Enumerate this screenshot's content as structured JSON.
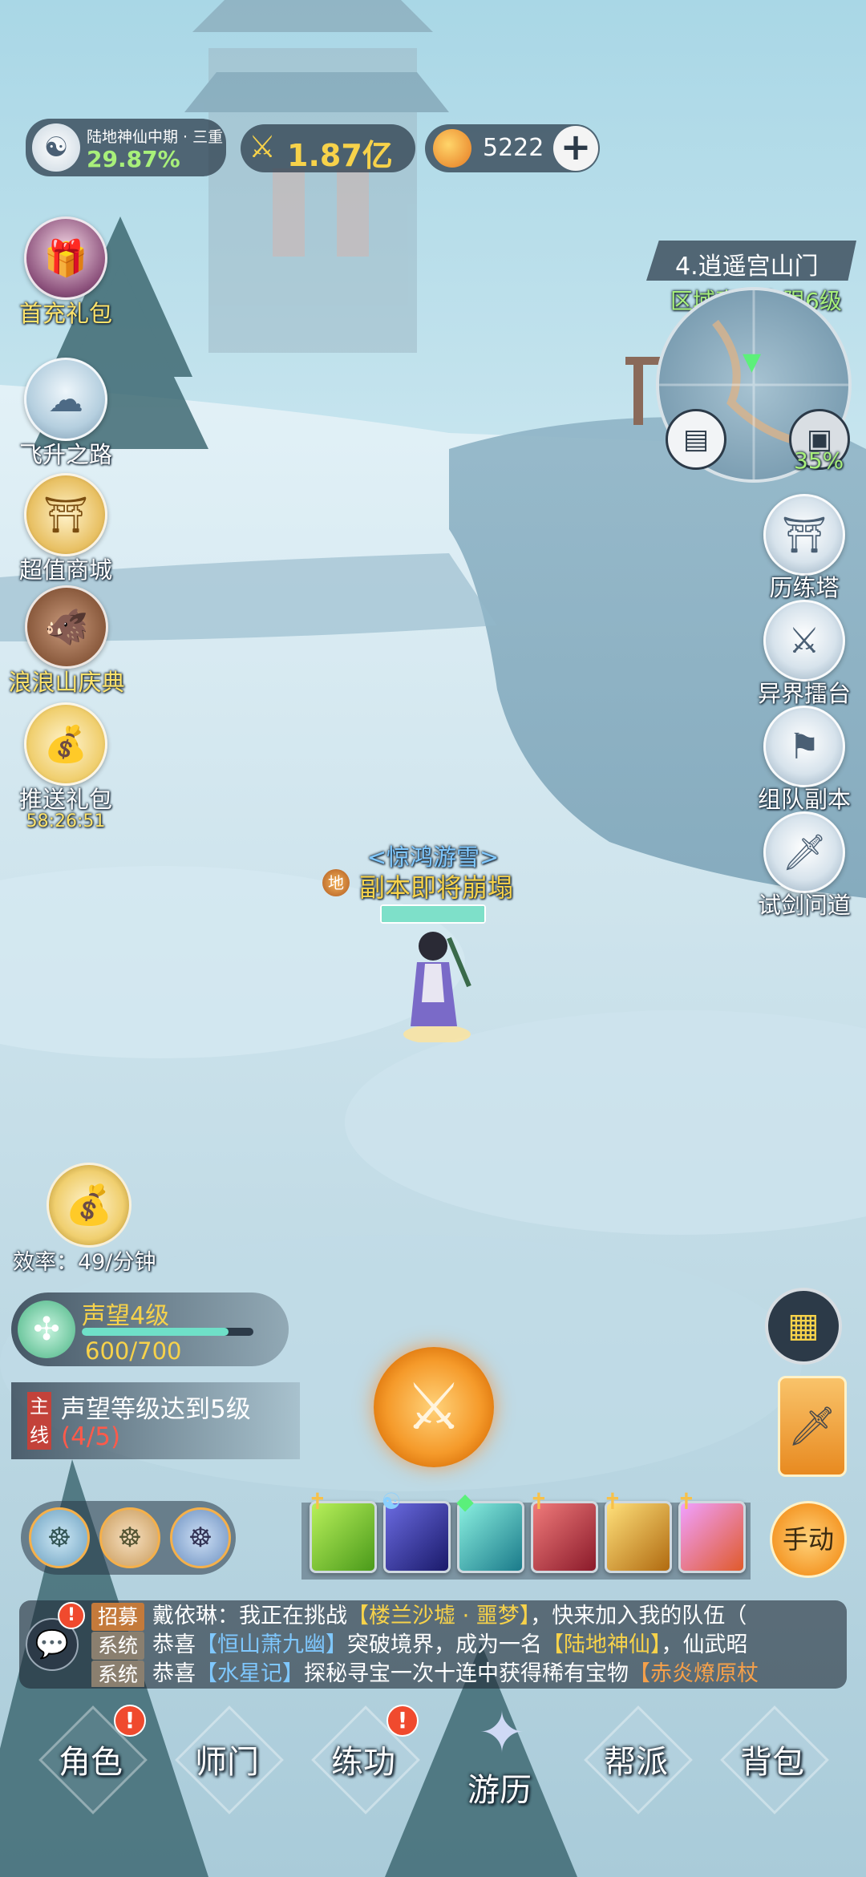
{
  "player": {
    "realm": "陆地神仙中期 · 三重",
    "progress_text": "29.87%",
    "power": "1.87亿",
    "currency": "5222",
    "add_symbol": "+"
  },
  "left_menu": [
    {
      "label": "首充礼包",
      "icon": "gift-girl-icon"
    },
    {
      "label": "飞升之路",
      "icon": "ascend-icon"
    },
    {
      "label": "超值商城",
      "icon": "shop-icon"
    },
    {
      "label": "浪浪山庆典",
      "icon": "boar-icon"
    },
    {
      "label": "推送礼包",
      "icon": "bag-icon",
      "timer": "58:26:51"
    }
  ],
  "map": {
    "location": "4.逍遥宫山门",
    "region_limit": "区域声望上限6级",
    "chest_percent": "35%"
  },
  "right_menu": [
    {
      "label": "历练塔",
      "icon": "tower-icon"
    },
    {
      "label": "异界擂台",
      "icon": "arena-icon"
    },
    {
      "label": "组队副本",
      "icon": "banner-icon"
    },
    {
      "label": "试剑问道",
      "icon": "sword-icon"
    }
  ],
  "character": {
    "title": "<惊鸿游雪>",
    "status": "副本即将崩塌",
    "rank_badge": "地",
    "hp_fraction": 1.0
  },
  "efficiency": {
    "label": "效率：",
    "value": "49/分钟"
  },
  "reputation": {
    "label": "声望4级",
    "value": "600/700",
    "fraction": 0.857
  },
  "quest": {
    "tag": "主线",
    "text": "声望等级达到5级",
    "progress": "(4/5)"
  },
  "auto_button": "手动",
  "chat": [
    {
      "tag": "招募",
      "tag_color": "#c47a3b",
      "segments": [
        {
          "text": "戴依琳：我正在挑战",
          "color": "#ffffff"
        },
        {
          "text": "【楼兰沙墟 · 噩梦】",
          "color": "#f7d24a"
        },
        {
          "text": "，快来加入我的队伍（",
          "color": "#ffffff"
        }
      ]
    },
    {
      "tag": "系统",
      "tag_color": "#8a7f6f",
      "segments": [
        {
          "text": "恭喜",
          "color": "#ffffff"
        },
        {
          "text": "【恒山萧九幽】",
          "color": "#7fc8ff"
        },
        {
          "text": "突破境界，成为一名",
          "color": "#ffffff"
        },
        {
          "text": "【陆地神仙】",
          "color": "#f7d24a"
        },
        {
          "text": "，仙武昭",
          "color": "#ffffff"
        }
      ]
    },
    {
      "tag": "系统",
      "tag_color": "#8a7f6f",
      "segments": [
        {
          "text": "恭喜",
          "color": "#ffffff"
        },
        {
          "text": "【水星记】",
          "color": "#7fc8ff"
        },
        {
          "text": "探秘寻宝一次十连中获得稀有宝物",
          "color": "#ffffff"
        },
        {
          "text": "【赤炎燎原杖",
          "color": "#f5a04a"
        }
      ]
    }
  ],
  "nav": [
    {
      "label": "角色",
      "badge": "!"
    },
    {
      "label": "师门",
      "badge": ""
    },
    {
      "label": "练功",
      "badge": "!"
    },
    {
      "label": "游历",
      "badge": ""
    },
    {
      "label": "帮派",
      "badge": ""
    },
    {
      "label": "背包",
      "badge": ""
    }
  ],
  "colors": {
    "gold": "#f7d24a",
    "green": "#a8f07a",
    "orange_button": "#f59a2a",
    "dark_panel": "#2c3a48"
  }
}
